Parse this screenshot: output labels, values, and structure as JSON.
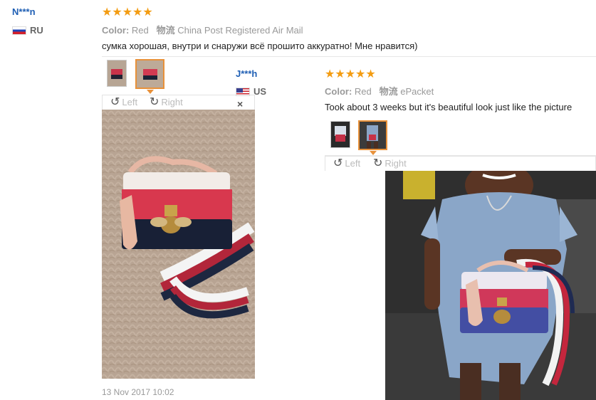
{
  "reviews": [
    {
      "user": "N***n",
      "country": "RU",
      "stars": "★★★★★",
      "color_label": "Color:",
      "color_value": "Red",
      "shipping_label": "物流",
      "shipping_value": "China Post Registered Air Mail",
      "text": "сумка хорошая, внутри и снаружи всё прошито аккуратно! Мне нравится)",
      "date": "13 Nov 2017 10:02"
    },
    {
      "user": "J***h",
      "country": "US",
      "stars": "★★★★★",
      "color_label": "Color:",
      "color_value": "Red",
      "shipping_label": "物流",
      "shipping_value": "ePacket",
      "text": "Took about 3 weeks but it's beautiful look just like the picture"
    }
  ],
  "viewer": {
    "left_label": "Left",
    "right_label": "Right",
    "close_glyph": "×",
    "rotate_left_glyph": "↺",
    "rotate_right_glyph": "↻"
  },
  "colors": {
    "accent_star": "#f39c12",
    "username": "#1f5fb4",
    "thumb_active_border": "#e8913a"
  }
}
